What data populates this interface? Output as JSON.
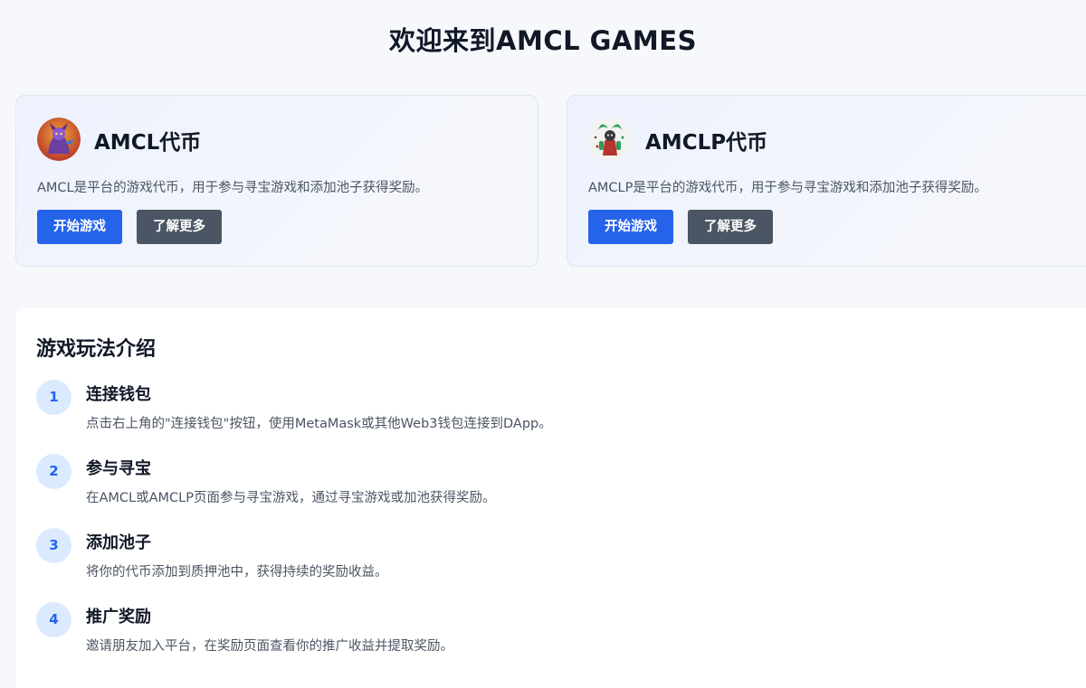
{
  "page": {
    "title": "欢迎来到AMCL GAMES"
  },
  "tokens": [
    {
      "name": "AMCL代币",
      "description": "AMCL是平台的游戏代币，用于参与寻宝游戏和添加池子获得奖励。",
      "start_label": "开始游戏",
      "more_label": "了解更多"
    },
    {
      "name": "AMCLP代币",
      "description": "AMCLP是平台的游戏代币，用于参与寻宝游戏和添加池子获得奖励。",
      "start_label": "开始游戏",
      "more_label": "了解更多"
    }
  ],
  "guide": {
    "title": "游戏玩法介绍",
    "steps": [
      {
        "num": "1",
        "title": "连接钱包",
        "desc": "点击右上角的\"连接钱包\"按钮，使用MetaMask或其他Web3钱包连接到DApp。"
      },
      {
        "num": "2",
        "title": "参与寻宝",
        "desc": "在AMCL或AMCLP页面参与寻宝游戏，通过寻宝游戏或加池获得奖励。"
      },
      {
        "num": "3",
        "title": "添加池子",
        "desc": "将你的代币添加到质押池中，获得持续的奖励收益。"
      },
      {
        "num": "4",
        "title": "推广奖励",
        "desc": "邀请朋友加入平台，在奖励页面查看你的推广收益并提取奖励。"
      }
    ]
  },
  "colors": {
    "primary": "#2563eb",
    "secondary": "#4b5563",
    "step_badge_bg": "#dbeafe",
    "background": "#f6f8fb"
  },
  "icons": [
    "amcl-token-avatar-icon",
    "amclp-token-avatar-icon"
  ]
}
